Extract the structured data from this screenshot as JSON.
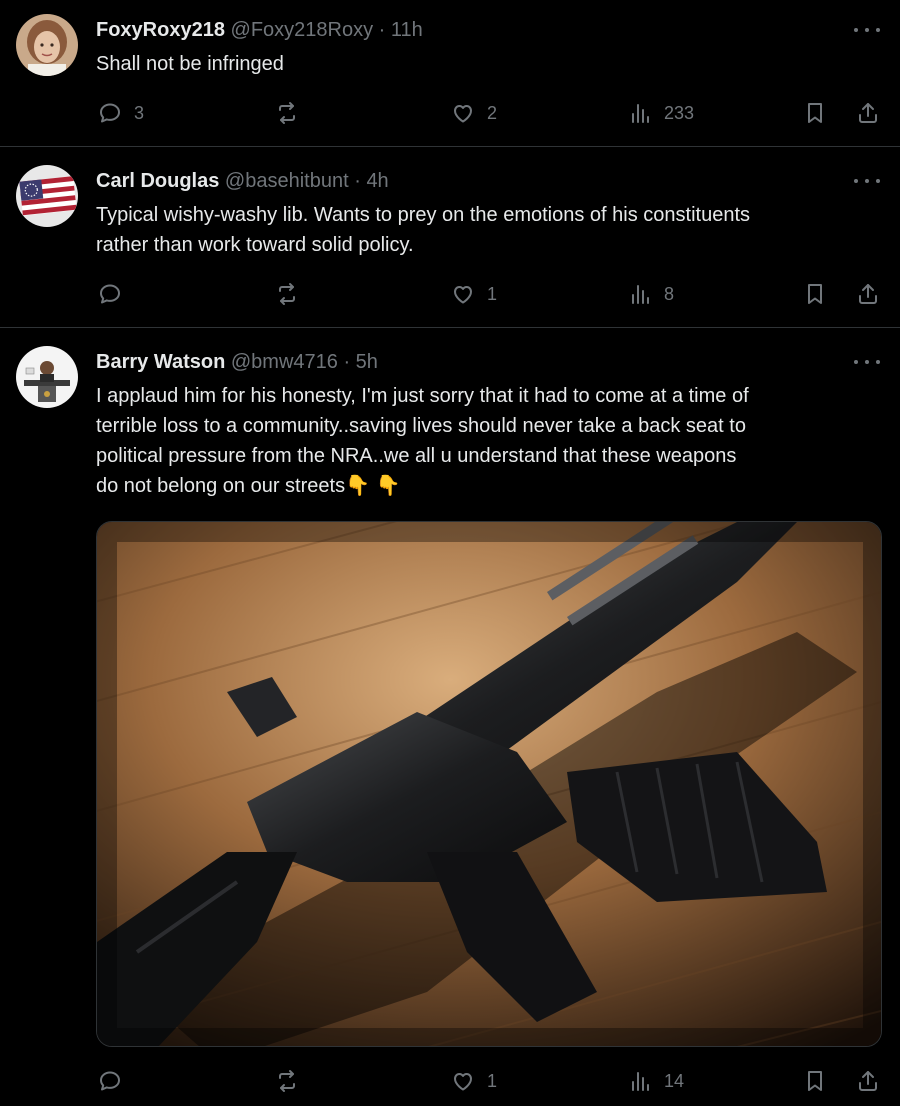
{
  "posts": [
    {
      "display_name": "FoxyRoxy218",
      "handle": "@Foxy218Roxy",
      "time": "11h",
      "lines": [
        "Shall not be infringed"
      ],
      "replies": "3",
      "reposts": "",
      "likes": "2",
      "views": "233"
    },
    {
      "display_name": "Carl Douglas",
      "handle": "@basehitbunt",
      "time": "4h",
      "lines": [
        "Typical wishy-washy lib. Wants to prey on the emotions of his constituents",
        "rather than work toward solid policy."
      ],
      "replies": "",
      "reposts": "",
      "likes": "1",
      "views": "8"
    },
    {
      "display_name": "Barry Watson",
      "handle": "@bmw4716",
      "time": "5h",
      "lines": [
        "I applaud him for his honesty, I'm just sorry that it had to come at a time of",
        "terrible loss to a community..saving lives should never take a back seat to",
        "political pressure from the NRA..we all u understand that these weapons",
        "do not belong on our streets👇 👇"
      ],
      "replies": "",
      "reposts": "",
      "likes": "1",
      "views": "14"
    }
  ],
  "separator": " · ",
  "icons": {
    "reply": "reply-icon",
    "repost": "repost-icon",
    "like": "heart-icon",
    "views": "views-icon",
    "bookmark": "bookmark-icon",
    "share": "share-icon",
    "more": "more-icon"
  },
  "colors": {
    "background": "#000000",
    "text": "#e7e9ea",
    "muted": "#71767b",
    "divider": "#2f3336"
  }
}
